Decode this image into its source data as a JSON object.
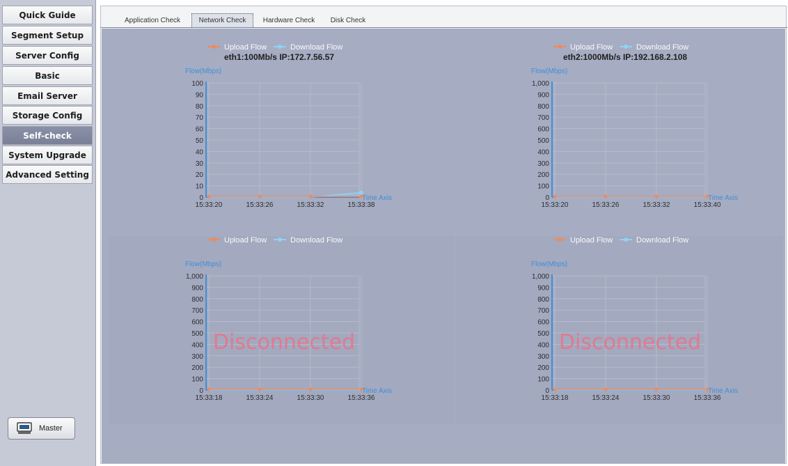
{
  "sidebar": {
    "items": [
      {
        "label": "Quick Guide",
        "active": false
      },
      {
        "label": "Segment Setup",
        "active": false
      },
      {
        "label": "Server Config",
        "active": false
      },
      {
        "label": "Basic",
        "active": false
      },
      {
        "label": "Email Server",
        "active": false
      },
      {
        "label": "Storage Config",
        "active": false
      },
      {
        "label": "Self-check",
        "active": true
      },
      {
        "label": "System Upgrade",
        "active": false
      },
      {
        "label": "Advanced Setting",
        "active": false
      }
    ],
    "master_button": {
      "label": "Master",
      "icon": "monitor-icon"
    }
  },
  "tabs": [
    {
      "label": "Application Check",
      "active": false
    },
    {
      "label": "Network Check",
      "active": true
    },
    {
      "label": "Hardware Check",
      "active": false
    },
    {
      "label": "Disk Check",
      "active": false
    }
  ],
  "colors": {
    "upload": "#f08a5c",
    "download": "#8fd3f5",
    "axis_label": "#3f8fd6",
    "disconnected": "#e07a90",
    "title": "#1f1f1f"
  },
  "chart_data": [
    {
      "type": "line",
      "title": "eth1:100Mb/s IP:172.7.56.57",
      "ylabel": "Flow(Mbps)",
      "xlabel": "Time Axis",
      "ylim": [
        0,
        100
      ],
      "yticks": [
        "0",
        "10",
        "20",
        "30",
        "40",
        "50",
        "60",
        "70",
        "80",
        "90",
        "100"
      ],
      "x": [
        "15:33:20",
        "15:33:26",
        "15:33:32",
        "15:33:38"
      ],
      "series": [
        {
          "name": "Upload Flow",
          "values": [
            0,
            0,
            0,
            0
          ]
        },
        {
          "name": "Download Flow",
          "values": [
            0,
            0,
            0,
            4
          ]
        }
      ],
      "legend": "top",
      "grid": true,
      "status_text": ""
    },
    {
      "type": "line",
      "title": "eth2:1000Mb/s IP:192.168.2.108",
      "ylabel": "Flow(Mbps)",
      "xlabel": "Time Axis",
      "ylim": [
        0,
        1000
      ],
      "yticks": [
        "0",
        "100",
        "200",
        "300",
        "400",
        "500",
        "600",
        "700",
        "800",
        "900",
        "1,000"
      ],
      "x": [
        "15:33:20",
        "15:33:26",
        "15:33:32",
        "15:33:40"
      ],
      "series": [
        {
          "name": "Upload Flow",
          "values": [
            0,
            0,
            0,
            0
          ]
        },
        {
          "name": "Download Flow",
          "values": [
            0,
            0,
            0,
            0
          ]
        }
      ],
      "legend": "top",
      "grid": true,
      "status_text": ""
    },
    {
      "type": "line",
      "title": "",
      "ylabel": "Flow(Mbps)",
      "xlabel": "Time Axis",
      "ylim": [
        0,
        1000
      ],
      "yticks": [
        "0",
        "100",
        "200",
        "300",
        "400",
        "500",
        "600",
        "700",
        "800",
        "900",
        "1,000"
      ],
      "x": [
        "15:33:18",
        "15:33:24",
        "15:33:30",
        "15:33:36"
      ],
      "series": [
        {
          "name": "Upload Flow",
          "values": [
            0,
            0,
            0,
            0
          ]
        },
        {
          "name": "Download Flow",
          "values": [
            0,
            0,
            0,
            0
          ]
        }
      ],
      "legend": "top",
      "grid": true,
      "status_text": "Disconnected"
    },
    {
      "type": "line",
      "title": "",
      "ylabel": "Flow(Mbps)",
      "xlabel": "Time Axis",
      "ylim": [
        0,
        1000
      ],
      "yticks": [
        "0",
        "100",
        "200",
        "300",
        "400",
        "500",
        "600",
        "700",
        "800",
        "900",
        "1,000"
      ],
      "x": [
        "15:33:18",
        "15:33:24",
        "15:33:30",
        "15:33:36"
      ],
      "series": [
        {
          "name": "Upload Flow",
          "values": [
            0,
            0,
            0,
            0
          ]
        },
        {
          "name": "Download Flow",
          "values": [
            0,
            0,
            0,
            0
          ]
        }
      ],
      "legend": "top",
      "grid": true,
      "status_text": "Disconnected"
    }
  ]
}
